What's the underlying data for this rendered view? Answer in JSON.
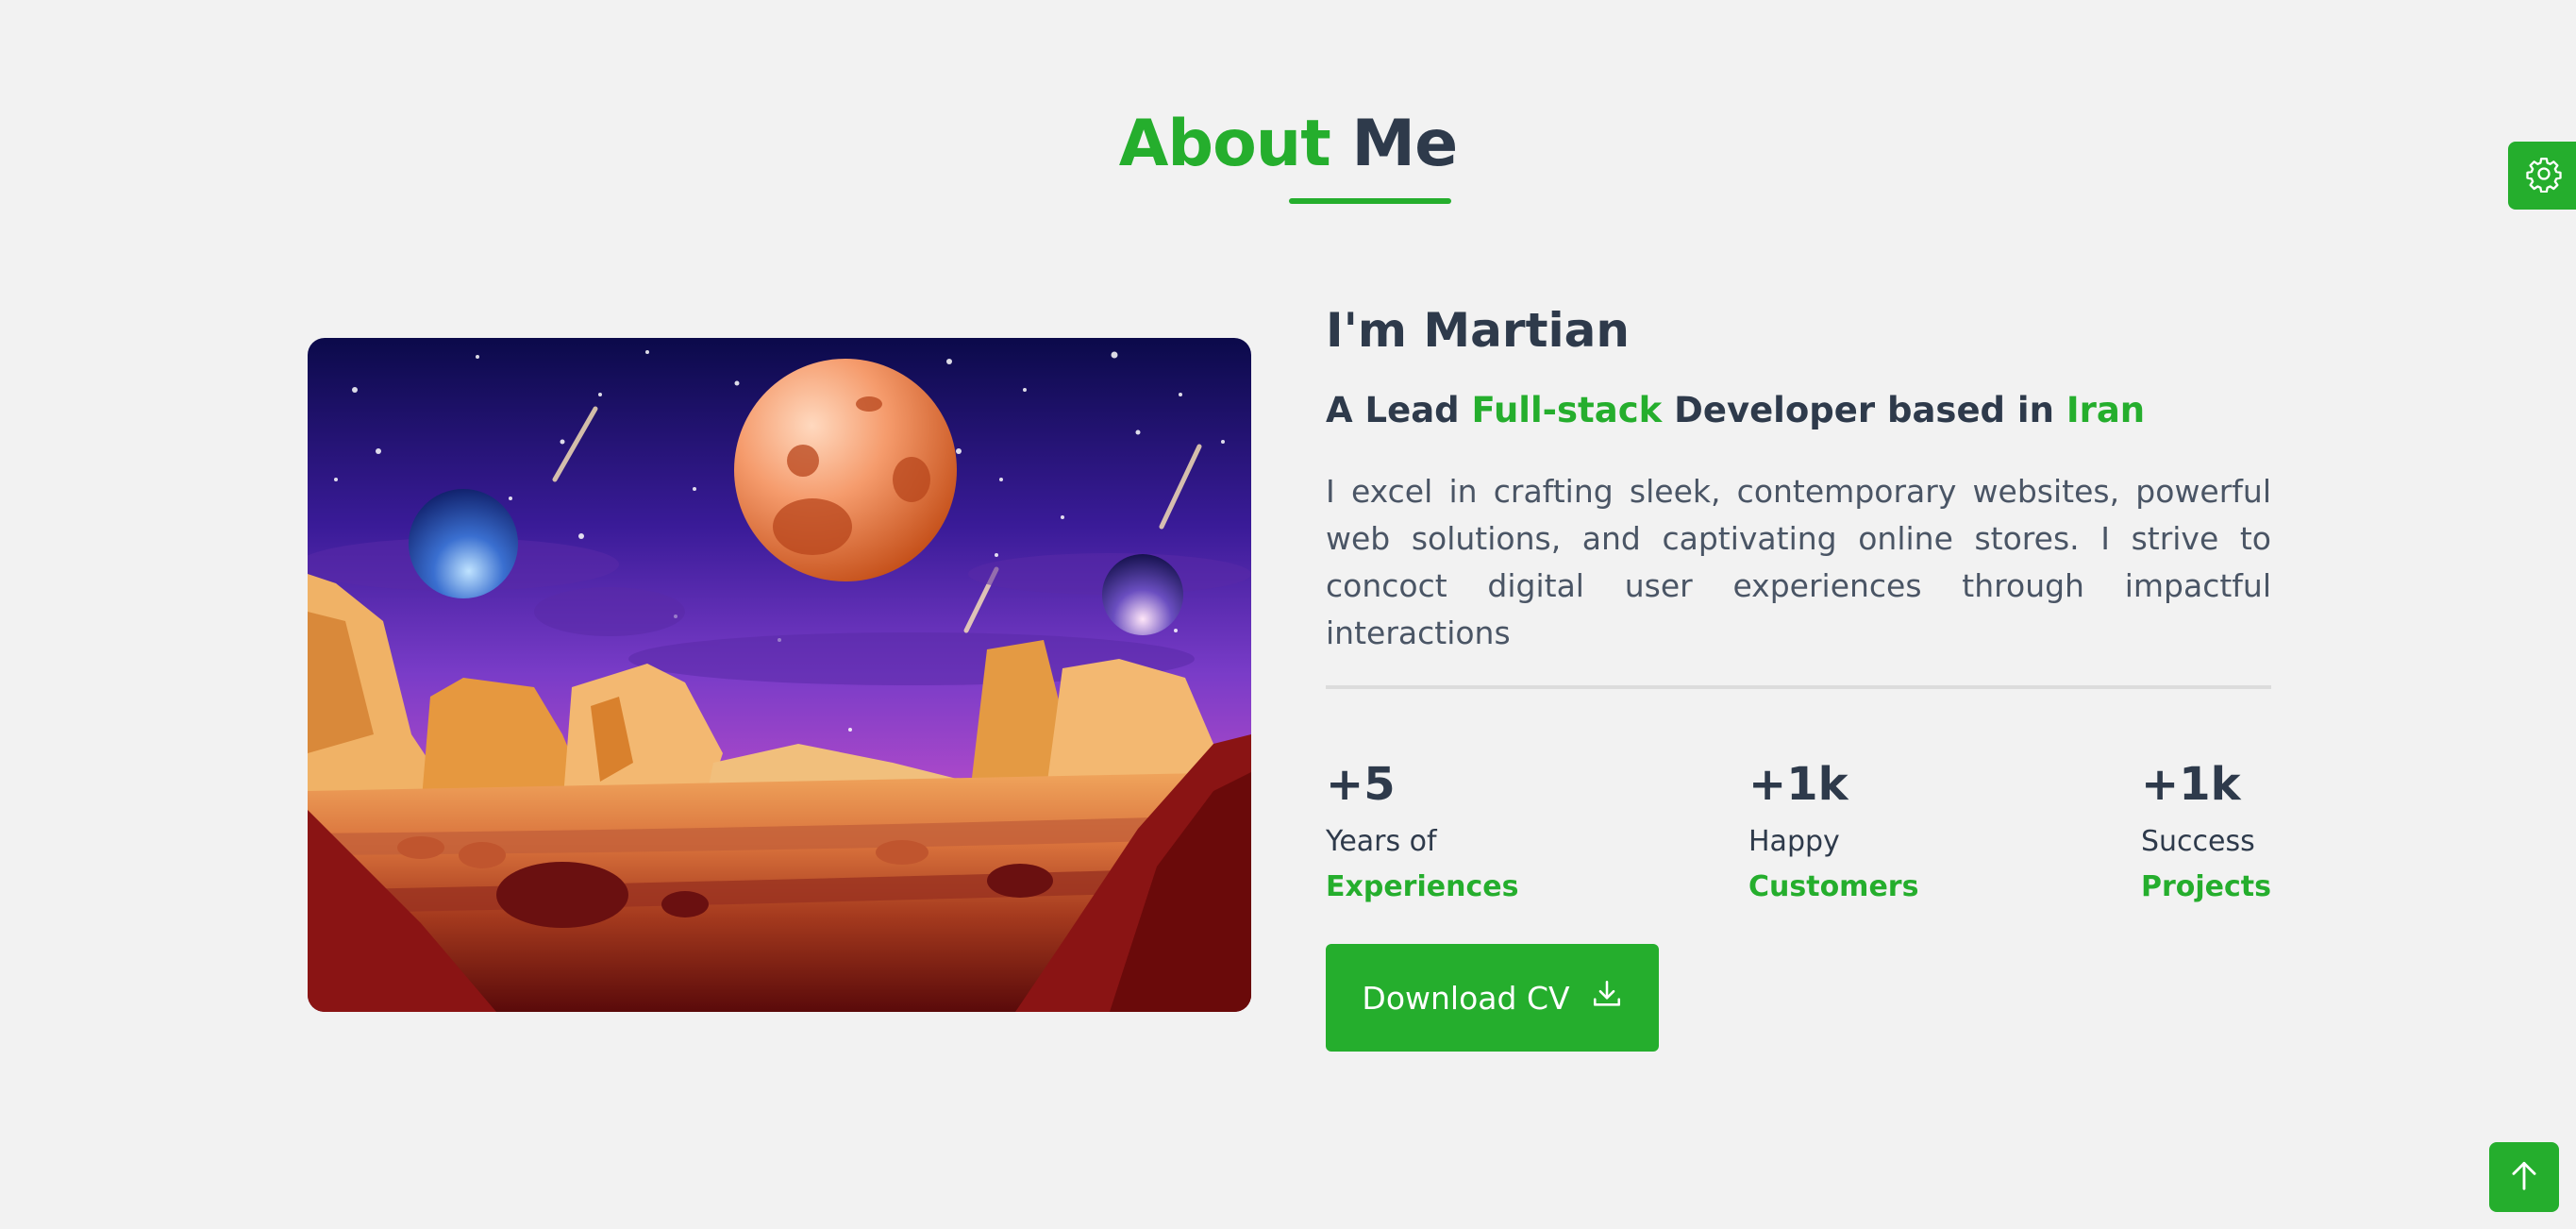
{
  "section": {
    "title_accent": "About",
    "title_rest": "Me"
  },
  "profile": {
    "greeting": "I'm Martian",
    "role_prefix": "A Lead",
    "role_highlight": "Full-stack",
    "role_middle": "Developer based in",
    "role_location": "Iran",
    "bio": "I excel in crafting sleek, contemporary websites, powerful web solutions, and captivating online stores. I strive to concoct digital user experiences through impactful interactions"
  },
  "stats": [
    {
      "value": "+5",
      "label": "Years of",
      "highlight": "Experiences"
    },
    {
      "value": "+1k",
      "label": "Happy",
      "highlight": "Customers"
    },
    {
      "value": "+1k",
      "label": "Success",
      "highlight": "Projects"
    }
  ],
  "actions": {
    "download_label": "Download CV"
  },
  "icons": {
    "settings": "gear-icon",
    "scroll_top": "arrow-up-icon",
    "download": "download-icon"
  },
  "colors": {
    "accent": "#25ae2d",
    "text_dark": "#2e3a4b",
    "background": "#f2f2f2"
  }
}
